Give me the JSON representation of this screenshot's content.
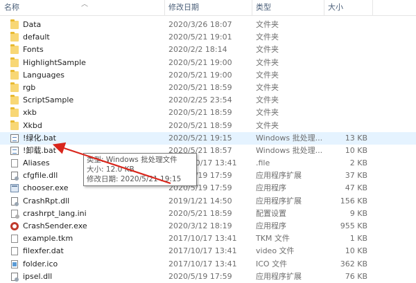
{
  "header": {
    "name": "名称",
    "date": "修改日期",
    "type": "类型",
    "size": "大小",
    "sort_icon": "chevron-up-icon"
  },
  "files": [
    {
      "name": "Data",
      "date": "2020/3/26 18:07",
      "type": "文件夹",
      "size": "",
      "icon": "folder"
    },
    {
      "name": "default",
      "date": "2020/5/21 19:01",
      "type": "文件夹",
      "size": "",
      "icon": "folder"
    },
    {
      "name": "Fonts",
      "date": "2020/2/2 18:14",
      "type": "文件夹",
      "size": "",
      "icon": "folder"
    },
    {
      "name": "HighlightSample",
      "date": "2020/5/21 19:00",
      "type": "文件夹",
      "size": "",
      "icon": "folder"
    },
    {
      "name": "Languages",
      "date": "2020/5/21 19:00",
      "type": "文件夹",
      "size": "",
      "icon": "folder"
    },
    {
      "name": "rgb",
      "date": "2020/5/21 18:59",
      "type": "文件夹",
      "size": "",
      "icon": "folder"
    },
    {
      "name": "ScriptSample",
      "date": "2020/2/25 23:54",
      "type": "文件夹",
      "size": "",
      "icon": "folder"
    },
    {
      "name": "xkb",
      "date": "2020/5/21 18:59",
      "type": "文件夹",
      "size": "",
      "icon": "folder"
    },
    {
      "name": "Xkbd",
      "date": "2020/5/21 18:59",
      "type": "文件夹",
      "size": "",
      "icon": "folder"
    },
    {
      "name": "!绿化.bat",
      "date": "2020/5/21 19:15",
      "type": "Windows 批处理...",
      "size": "13 KB",
      "icon": "bat",
      "selected": true
    },
    {
      "name": "!卸载.bat",
      "date": "2020/5/21 18:57",
      "type": "Windows 批处理...",
      "size": "10 KB",
      "icon": "bat"
    },
    {
      "name": "Aliases",
      "date": "2017/10/17 13:41",
      "type": ".file",
      "size": "2 KB",
      "icon": "file"
    },
    {
      "name": "cfgfile.dll",
      "date": "2020/5/19 17:59",
      "type": "应用程序扩展",
      "size": "37 KB",
      "icon": "dll"
    },
    {
      "name": "chooser.exe",
      "date": "2020/5/19 17:59",
      "type": "应用程序",
      "size": "47 KB",
      "icon": "exe"
    },
    {
      "name": "CrashRpt.dll",
      "date": "2019/1/21 14:50",
      "type": "应用程序扩展",
      "size": "156 KB",
      "icon": "dll"
    },
    {
      "name": "crashrpt_lang.ini",
      "date": "2020/5/21 18:59",
      "type": "配置设置",
      "size": "9 KB",
      "icon": "ini"
    },
    {
      "name": "CrashSender.exe",
      "date": "2020/3/12 18:19",
      "type": "应用程序",
      "size": "955 KB",
      "icon": "sender"
    },
    {
      "name": "example.tkm",
      "date": "2017/10/17 13:41",
      "type": "TKM 文件",
      "size": "1 KB",
      "icon": "file"
    },
    {
      "name": "filexfer.dat",
      "date": "2017/10/17 13:41",
      "type": "video 文件",
      "size": "10 KB",
      "icon": "file"
    },
    {
      "name": "folder.ico",
      "date": "2017/10/17 13:41",
      "type": "ICO 文件",
      "size": "362 KB",
      "icon": "icofile"
    },
    {
      "name": "ipsel.dll",
      "date": "2020/5/19 17:59",
      "type": "应用程序扩展",
      "size": "76 KB",
      "icon": "dll"
    }
  ],
  "tooltip": {
    "line1": "类型: Windows 批处理文件",
    "line2": "大小: 12.0 KB",
    "line3": "修改日期: 2020/5/21 19:15"
  },
  "annotation": {
    "color": "#d9261c"
  }
}
